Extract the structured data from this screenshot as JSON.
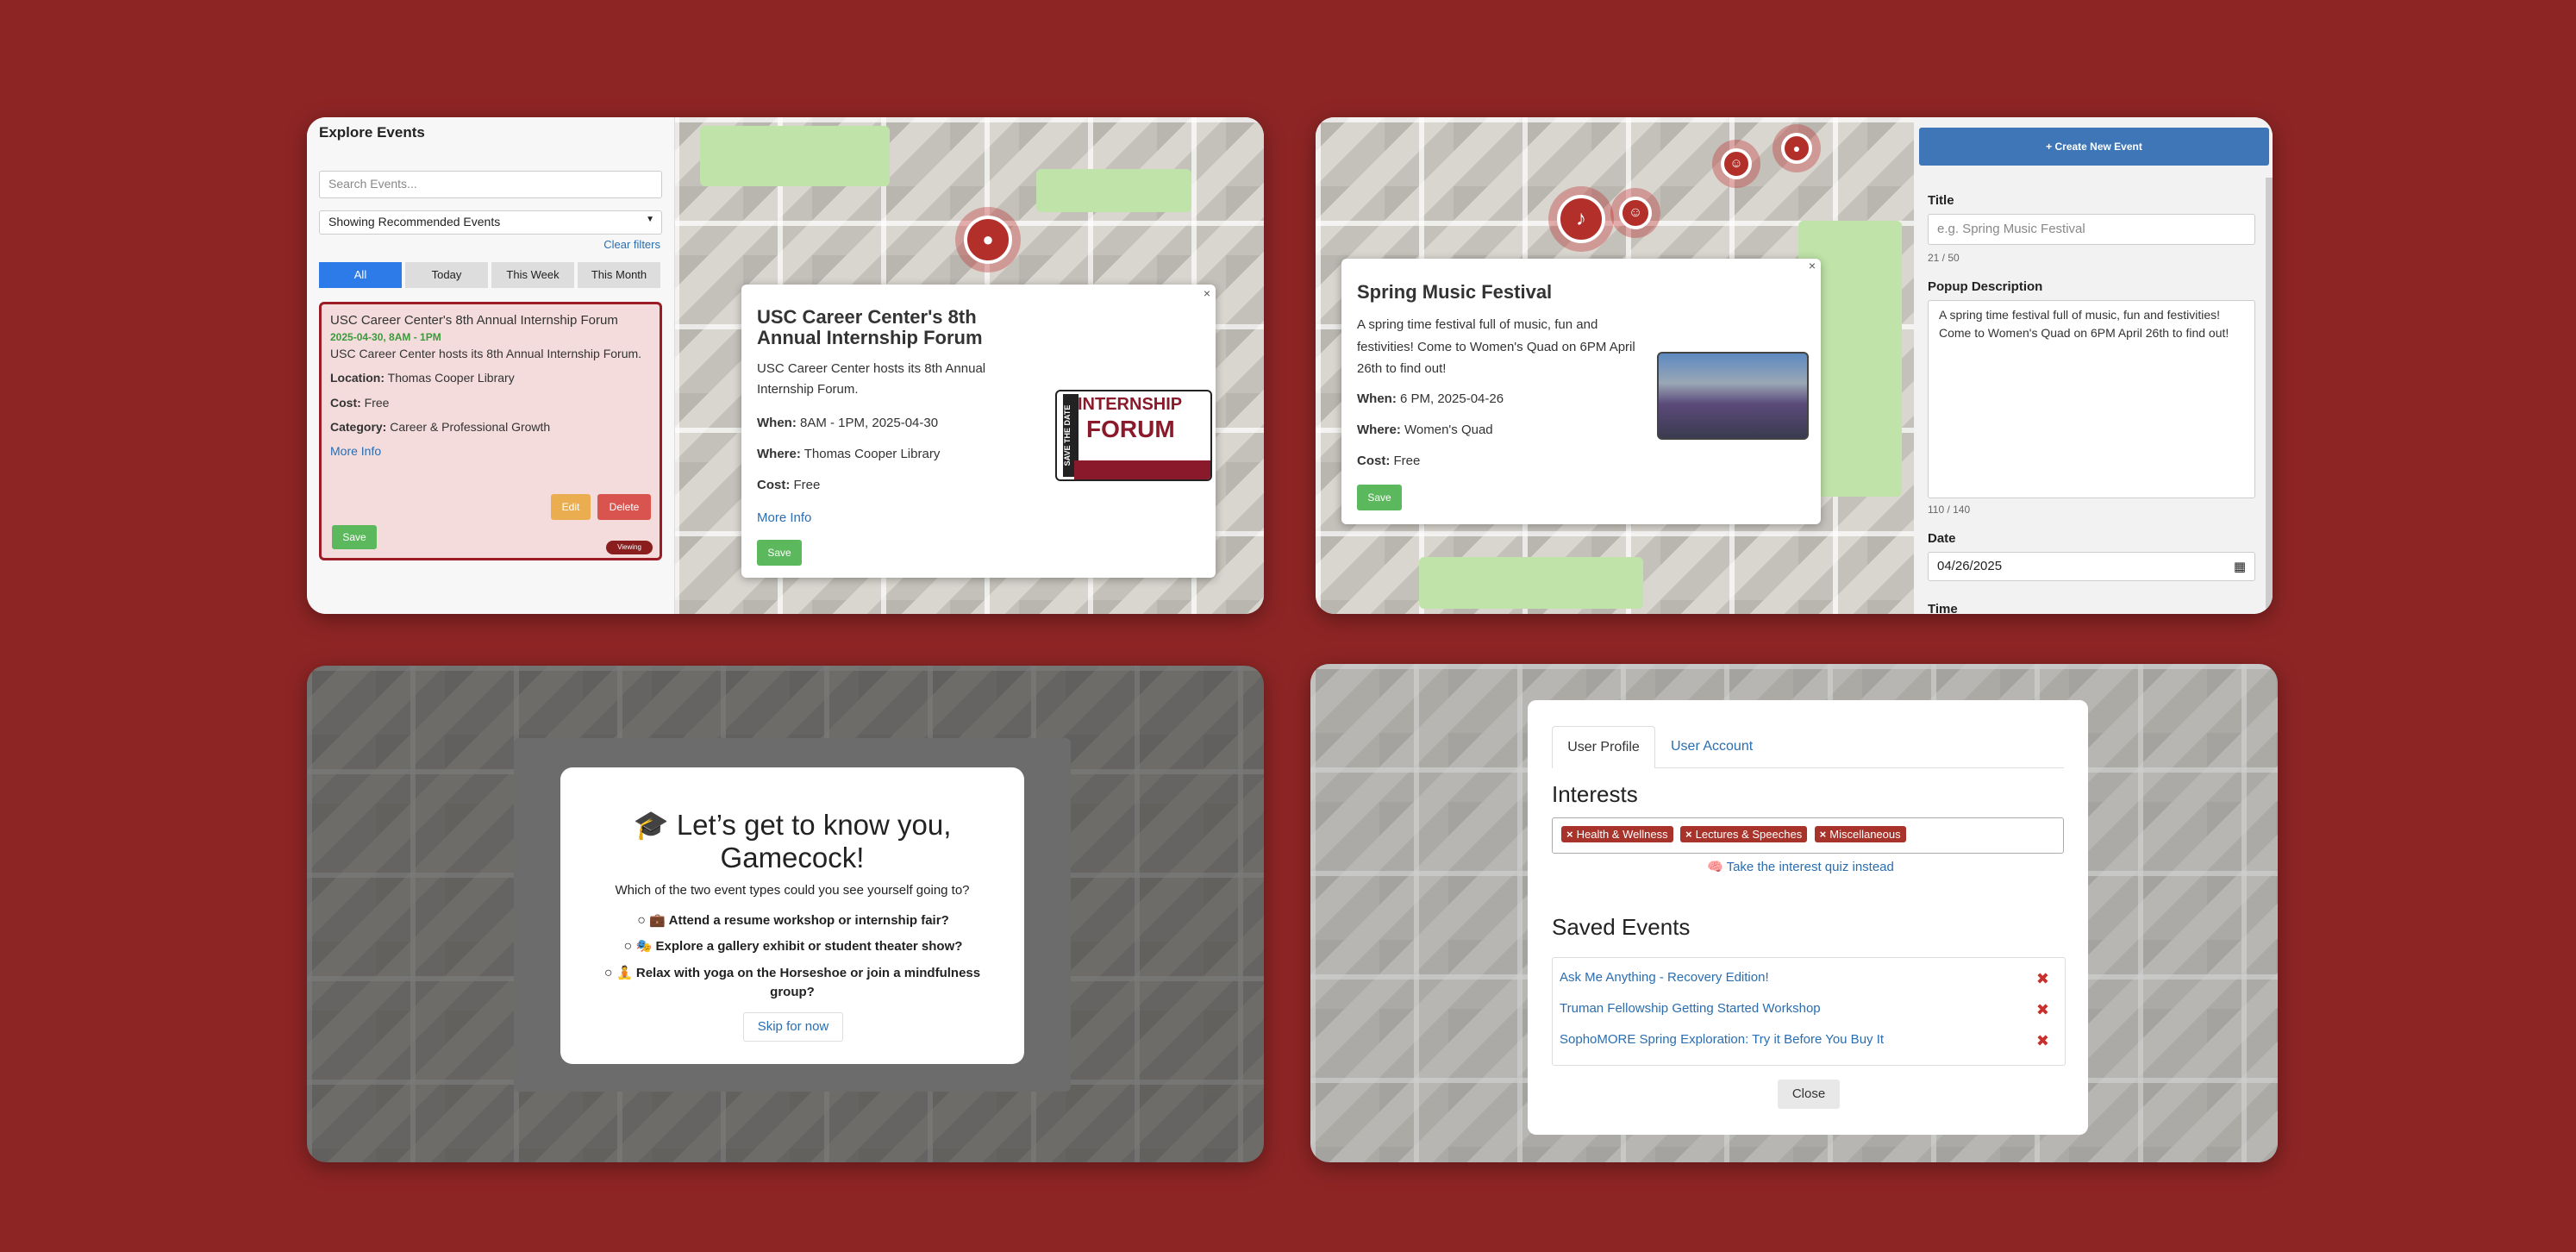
{
  "panel1": {
    "sidebar_title": "Explore Events",
    "search_placeholder": "Search Events...",
    "filter_select": "Showing Recommended Events",
    "clear_filters": "Clear filters",
    "tabs": [
      "All",
      "Today",
      "This Week",
      "This Month"
    ],
    "card": {
      "title": "USC Career Center's 8th Annual Internship Forum",
      "datetime": "2025-04-30, 8AM - 1PM",
      "description": "USC Career Center hosts its 8th Annual Internship Forum.",
      "location_label": "Location:",
      "location": "Thomas Cooper Library",
      "cost_label": "Cost:",
      "cost": "Free",
      "category_label": "Category:",
      "category": "Career & Professional Growth",
      "more_info": "More Info",
      "edit": "Edit",
      "delete": "Delete",
      "save": "Save",
      "status": "Viewing"
    },
    "popup": {
      "title": "USC Career Center's 8th Annual Internship Forum",
      "description": "USC Career Center hosts its 8th Annual Internship Forum.",
      "when_label": "When:",
      "when": "8AM - 1PM, 2025-04-30",
      "where_label": "Where:",
      "where": "Thomas Cooper Library",
      "cost_label": "Cost:",
      "cost": "Free",
      "more_info": "More Info",
      "save": "Save",
      "close": "×",
      "image_side_text": "SAVE THE DATE",
      "image_text_1": "INTERNSHIP",
      "image_text_2": "FORUM"
    }
  },
  "panel2": {
    "popup": {
      "title": "Spring Music Festival",
      "description": "A spring time festival full of music, fun and festivities! Come to Women's Quad on 6PM April 26th to find out!",
      "when_label": "When:",
      "when": "6 PM, 2025-04-26",
      "where_label": "Where:",
      "where": "Women's Quad",
      "cost_label": "Cost:",
      "cost": "Free",
      "save": "Save",
      "close": "×"
    },
    "form": {
      "create_button": "+ Create New Event",
      "title_label": "Title",
      "title_placeholder": "e.g. Spring Music Festival",
      "title_count": "21 / 50",
      "desc_label": "Popup Description",
      "desc_value": "A spring time festival full of music, fun and festivities! Come to Women's Quad on 6PM April 26th to find out!",
      "desc_count": "110 / 140",
      "date_label": "Date",
      "date_value": "04/26/2025",
      "time_label": "Time"
    }
  },
  "panel3": {
    "heading": "🎓 Let’s get to know you, Gamecock!",
    "question": "Which of the two event types could you see yourself going to?",
    "options": [
      "💼 Attend a resume workshop or internship fair?",
      "🎭 Explore a gallery exhibit or student theater show?",
      "🧘 Relax with yoga on the Horseshoe or join a mindfulness group?"
    ],
    "skip": "Skip for now"
  },
  "panel4": {
    "tabs": [
      "User Profile",
      "User Account"
    ],
    "interests_heading": "Interests",
    "interests": [
      "Health & Wellness",
      "Lectures & Speeches",
      "Miscellaneous"
    ],
    "quiz_link": "🧠 Take the interest quiz instead",
    "saved_heading": "Saved Events",
    "saved_events": [
      "Ask Me Anything - Recovery Edition!",
      "Truman Fellowship Getting Started Workshop",
      "SophoMORE Spring Exploration: Try it Before You Buy It"
    ],
    "close": "Close"
  }
}
